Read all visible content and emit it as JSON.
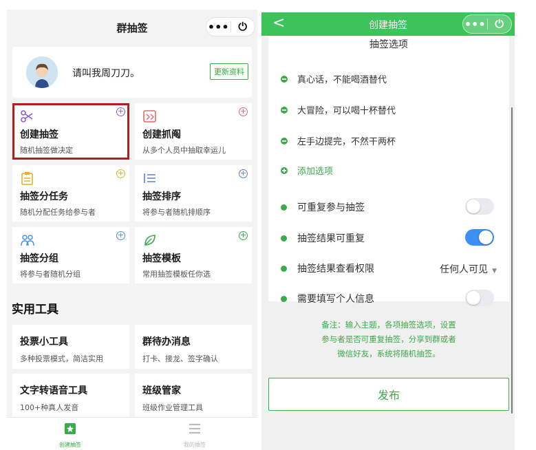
{
  "left": {
    "title": "群抽签",
    "capsule": {
      "more": "•••",
      "close": "⏻"
    },
    "profile": {
      "name": "请叫我周刀刀。",
      "update_label": "更新资料"
    },
    "cards": [
      {
        "title": "创建抽签",
        "subtitle": "随机抽签做决定",
        "color": "#8e5bd6",
        "highlighted": true
      },
      {
        "title": "创建抓阄",
        "subtitle": "从多个人员中抽取幸运儿",
        "color": "#e06b6b"
      },
      {
        "title": "抽签分任务",
        "subtitle": "随机分配任务给参与者",
        "color": "#e8b020"
      },
      {
        "title": "抽签排序",
        "subtitle": "将参与者随机排顺序",
        "color": "#5b7fd6"
      },
      {
        "title": "抽签分组",
        "subtitle": "将参与者随机分组",
        "color": "#4a8fe0"
      },
      {
        "title": "抽签模板",
        "subtitle": "常用抽签模板任你选",
        "color": "#3aaa4a"
      }
    ],
    "tools_title": "实用工具",
    "tools": [
      {
        "title": "投票小工具",
        "subtitle": "多种投票模式，简洁实用"
      },
      {
        "title": "群待办消息",
        "subtitle": "打卡、接龙、签字确认"
      },
      {
        "title": "文字转语音工具",
        "subtitle": "100+种真人发音"
      },
      {
        "title": "班级管家",
        "subtitle": "班级作业管理工具"
      }
    ],
    "tabs": [
      {
        "label": "创建抽签",
        "active": true
      },
      {
        "label": "我的抽签",
        "active": false
      }
    ]
  },
  "right": {
    "nav_title": "创建抽签",
    "back": "<",
    "capsule": {
      "more": "•••",
      "close": "⏻"
    },
    "section_title": "抽签选项",
    "options": [
      "真心话，不能喝酒替代",
      "大冒险，可以喝十杯替代",
      "左手边提完，不然干两杯"
    ],
    "add_option": "添加选项",
    "settings": [
      {
        "label": "可重复参与抽签",
        "type": "toggle",
        "on": false
      },
      {
        "label": "抽签结果可重复",
        "type": "toggle",
        "on": true
      },
      {
        "label": "抽签结果查看权限",
        "type": "select",
        "value": "任何人可见",
        "arrow": "▼"
      },
      {
        "label": "需要填写个人信息",
        "type": "toggle",
        "on": false
      }
    ],
    "note_lines": [
      "备注：输入主题，各项抽签选项，设置",
      "参与者是否可重复抽签，分享到群或者",
      "微信好友，系统将随机抽签。"
    ],
    "publish": "发布"
  },
  "colors": {
    "brand_green": "#3cc35a",
    "accent_green": "#3aaa4a",
    "toggle_on": "#3d8ff2",
    "highlight": "#b31d1d"
  }
}
